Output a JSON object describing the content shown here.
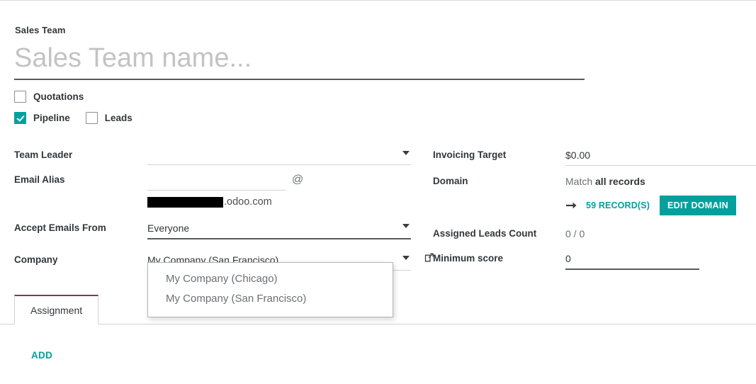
{
  "form": {
    "section_label": "Sales Team",
    "team_name": {
      "value": "",
      "placeholder": "Sales Team name..."
    },
    "feature_checkboxes": [
      {
        "label": "Quotations",
        "checked": false
      },
      {
        "label": "Pipeline",
        "checked": true
      },
      {
        "label": "Leads",
        "checked": false
      }
    ],
    "left_fields": {
      "team_leader": {
        "label": "Team Leader",
        "value": "",
        "placeholder": ""
      },
      "email_alias": {
        "label": "Email Alias",
        "value": "",
        "placeholder": "",
        "at_sign": "@",
        "domain_redacted": "",
        "domain_suffix": ".odoo.com"
      },
      "accept_emails_from": {
        "label": "Accept Emails From",
        "value": "Everyone"
      },
      "company": {
        "label": "Company",
        "value": "My Company (San Francisco)",
        "external_link_icon": "external-link-icon"
      }
    },
    "right_fields": {
      "invoicing_target": {
        "label": "Invoicing Target",
        "value": "$0.00"
      },
      "domain": {
        "label": "Domain",
        "match_prefix": "Match ",
        "match_strong": "all records",
        "arrow_icon": "arrow-right-icon",
        "records_link": "59 RECORD(S)",
        "edit_button": "EDIT DOMAIN"
      },
      "assigned_leads_count": {
        "label": "Assigned Leads Count",
        "value": "0 / 0"
      },
      "minimum_score": {
        "label": "Minimum score",
        "value": "0"
      }
    }
  },
  "dropdown": {
    "open": true,
    "options": [
      "My Company (Chicago)",
      "My Company (San Francisco)"
    ]
  },
  "tabs": [
    {
      "label": "Assignment",
      "active": true
    }
  ],
  "actions": {
    "add_label": "ADD"
  },
  "colors": {
    "accent_teal": "#00a09d",
    "tab_active_top": "#7d3c58",
    "text_primary": "#31373b",
    "text_muted": "#6b7075",
    "underline_light": "#d3d3d3",
    "underline_dark": "#5a5a5a"
  }
}
